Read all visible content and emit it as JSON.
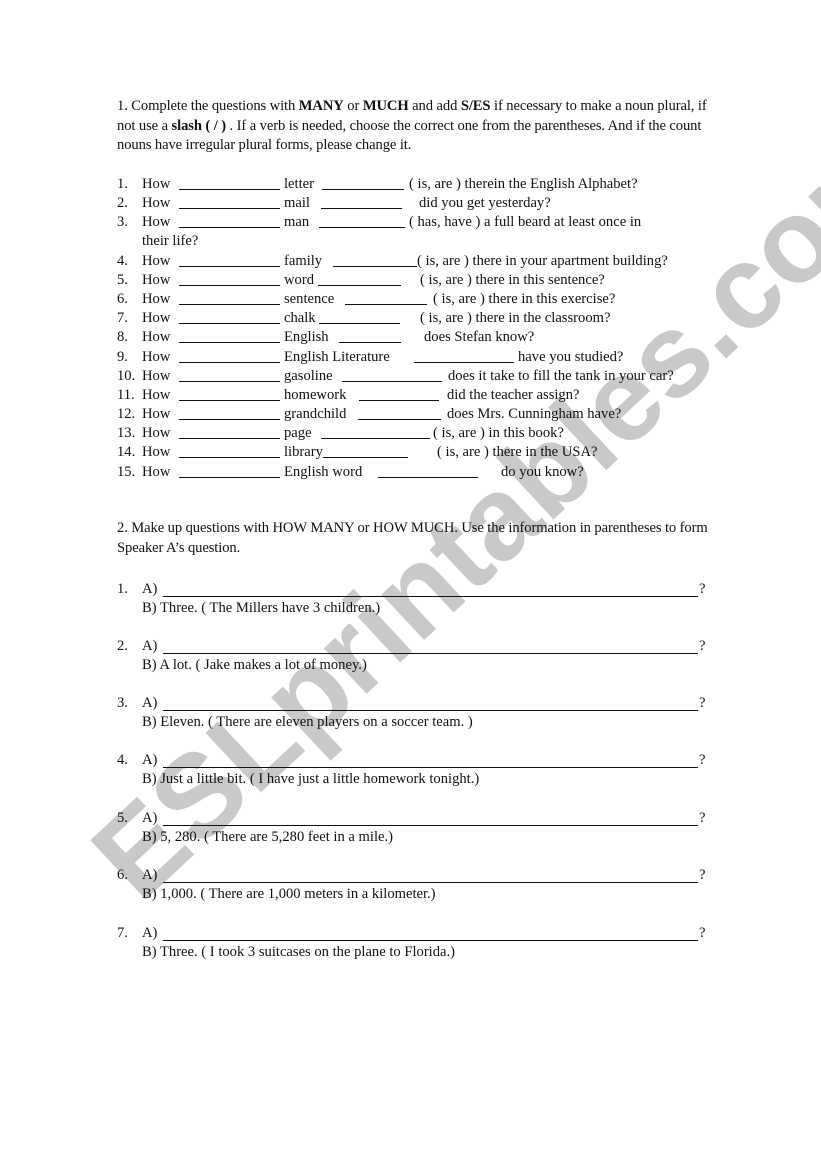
{
  "watermark": {
    "text": "ESLprintables.com",
    "color": "#c9c9c9"
  },
  "section1": {
    "instructions": {
      "part1": "1. Complete the questions with ",
      "bold1": "MANY",
      "part2": " or ",
      "bold2": "MUCH",
      "part3": " and add  ",
      "bold3": "S/ES",
      "part4": " if necessary to make a noun plural, if not use a ",
      "bold4": "slash ( / )",
      "part5": " . If a verb is needed, choose the correct one from the parentheses. And if the count nouns have irregular plural forms, please change it."
    },
    "items": [
      {
        "num": "1.",
        "how": "How",
        "noun": "letter",
        "rest": "( is, are ) therein the English Alphabet?"
      },
      {
        "num": "2.",
        "how": "How",
        "noun": "mail",
        "rest": "did you get yesterday?"
      },
      {
        "num": "3.",
        "how": "How",
        "noun": "man",
        "rest": "( has, have ) a full beard at least once in",
        "continuation": "their life?"
      },
      {
        "num": "4.",
        "how": "How",
        "noun": "family",
        "rest": "( is, are ) there in your apartment building?"
      },
      {
        "num": "5.",
        "how": "How",
        "noun": "word",
        "rest": "( is, are ) there in this sentence?"
      },
      {
        "num": "6.",
        "how": "How",
        "noun": "sentence",
        "rest": "( is, are ) there in this exercise?"
      },
      {
        "num": "7.",
        "how": "How",
        "noun": "chalk",
        "rest": "( is, are ) there in the classroom?"
      },
      {
        "num": "8.",
        "how": "How",
        "noun": "English",
        "rest": "does Stefan know?"
      },
      {
        "num": "9.",
        "how": "How",
        "noun": "English Literature",
        "rest": "have you studied?"
      },
      {
        "num": "10.",
        "how": "How",
        "noun": "gasoline",
        "rest": "does it take to fill the tank in your car?"
      },
      {
        "num": "11.",
        "how": "How",
        "noun": "homework",
        "rest": "did the teacher assign?"
      },
      {
        "num": "12.",
        "how": "How",
        "noun": "grandchild",
        "rest": "does Mrs. Cunningham have?"
      },
      {
        "num": "13.",
        "how": "How",
        "noun": "page",
        "rest": "( is, are ) in this book?"
      },
      {
        "num": "14.",
        "how": "How",
        "noun": "library",
        "rest": "( is, are ) there in the USA?"
      },
      {
        "num": "15.",
        "how": "How",
        "noun": "English word",
        "rest": "do you know?"
      }
    ]
  },
  "section2": {
    "instructions": "2. Make up questions with HOW MANY or HOW MUCH. Use the information in parentheses to form Speaker A’s question.",
    "items": [
      {
        "num": "1.",
        "a_label": "A)",
        "qmark": "?",
        "b_text": "B) Three. ( The Millers have 3 children.)"
      },
      {
        "num": "2.",
        "a_label": "A)",
        "qmark": "?",
        "b_text": "B) A lot. ( Jake makes a lot of money.)"
      },
      {
        "num": "3.",
        "a_label": "A)",
        "qmark": "?",
        "b_text": "B) Eleven. ( There are eleven players on a soccer team. )"
      },
      {
        "num": "4.",
        "a_label": "A)",
        "qmark": "?",
        "b_text": "B) Just  a little bit. ( I have just a little homework tonight.)"
      },
      {
        "num": "5.",
        "a_label": "A)",
        "qmark": "?",
        "b_text": "B) 5, 280. ( There are 5,280 feet in a mile.)"
      },
      {
        "num": "6.",
        "a_label": "A)",
        "qmark": "?",
        "b_text": "B) 1,000. ( There are 1,000 meters in a kilometer.)"
      },
      {
        "num": "7.",
        "a_label": "A)",
        "qmark": "?",
        "b_text": "B) Three. ( I took 3 suitcases on the plane to Florida.)"
      }
    ]
  }
}
